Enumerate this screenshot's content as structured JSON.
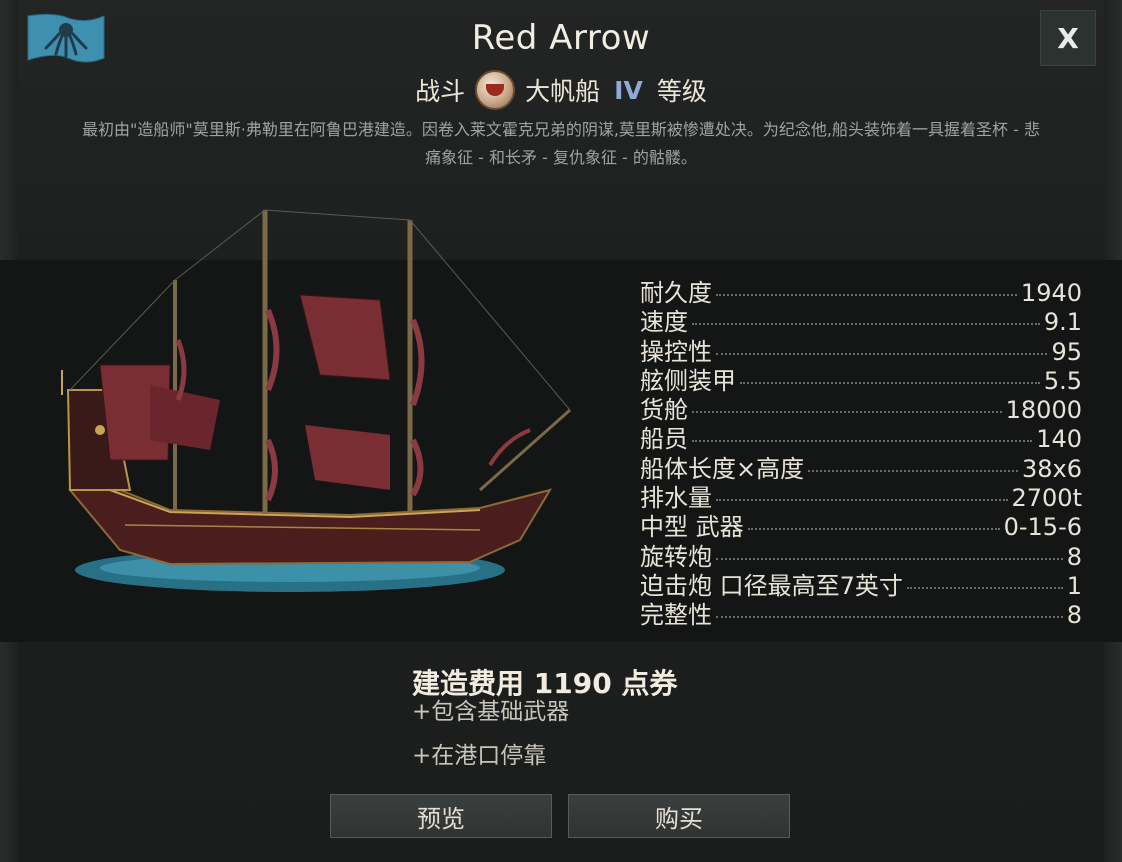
{
  "window": {
    "title": "Red Arrow",
    "close_label": "X",
    "flag_icon": "kraken-flag-icon"
  },
  "ship_class": {
    "role": "战斗",
    "type": "大帆船",
    "tier": "IV",
    "tier_label": "等级",
    "badge_icon": "cup-badge-icon"
  },
  "description": "最初由\"造船师\"莫里斯·弗勒里在阿鲁巴港建造。因卷入莱文霍克兄弟的阴谋,莫里斯被惨遭处决。为纪念他,船头装饰着一具握着圣杯 - 悲痛象征 - 和长矛 - 复仇象征 - 的骷髅。",
  "stats": [
    {
      "label": "耐久度",
      "value": "1940"
    },
    {
      "label": "速度",
      "value": "9.1"
    },
    {
      "label": "操控性",
      "value": "95"
    },
    {
      "label": "舷侧装甲",
      "value": "5.5"
    },
    {
      "label": "货舱",
      "value": "18000"
    },
    {
      "label": "船员",
      "value": "140"
    },
    {
      "label": "船体长度×高度",
      "value": "38x6"
    },
    {
      "label": "排水量",
      "value": "2700t"
    },
    {
      "label": "中型 武器",
      "value": "0-15-6"
    },
    {
      "label": "旋转炮",
      "value": "8"
    },
    {
      "label": "迫击炮 口径最高至7英寸",
      "value": "1"
    },
    {
      "label": "完整性",
      "value": "8"
    }
  ],
  "purchase": {
    "cost_text": "建造费用 1190 点券",
    "note_weapons": "+包含基础武器",
    "note_dock": "+在港口停靠"
  },
  "buttons": {
    "preview": "预览",
    "buy": "购买"
  },
  "colors": {
    "background": "#1d201f",
    "ship_band": "#141615",
    "tier_accent": "#8fa9d8",
    "flag": "#3f8fb0",
    "sail": "#7a2e34"
  }
}
